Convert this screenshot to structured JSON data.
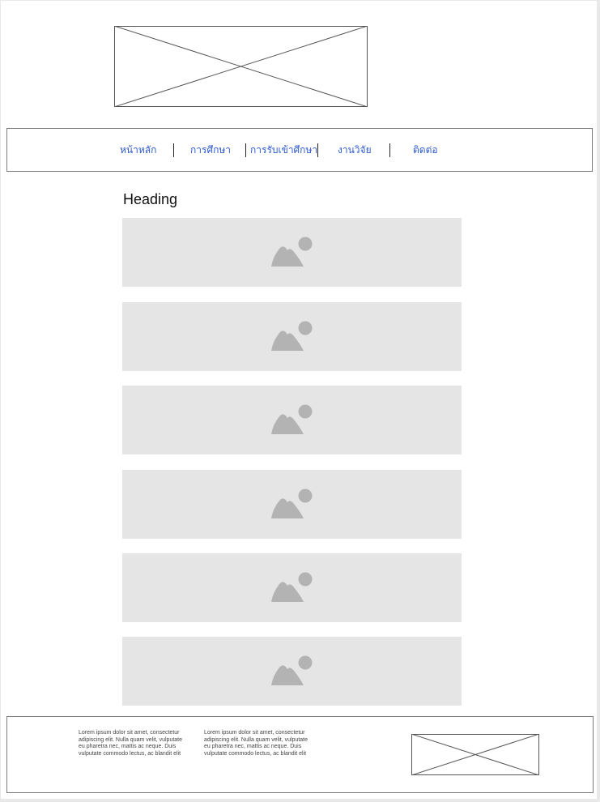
{
  "header": {
    "logo_icon": "image-placeholder-crossed-box"
  },
  "nav": {
    "items": [
      {
        "label": "หน้าหลัก"
      },
      {
        "label": "การศึกษา"
      },
      {
        "label": "การรับเข้าศึกษา"
      },
      {
        "label": "งานวิจัย"
      },
      {
        "label": "ติดต่อ"
      }
    ],
    "link_color": "#2f5bd0"
  },
  "main": {
    "heading": "Heading",
    "image_icon": "image-mountain-sun-icon",
    "image_count": 6
  },
  "footer": {
    "col1_text": "Lorem ipsum dolor sit amet, consectetur adipiscing elit. Nulla quam velit, vulputate eu pharetra nec, mattis ac neque. Duis vulputate commodo lectus, ac blandit elit",
    "col2_text": "Lorem ipsum dolor sit amet, consectetur adipiscing elit. Nulla quam velit, vulputate eu pharetra nec, mattis ac neque. Duis vulputate commodo lectus, ac blandit elit",
    "logo_icon": "image-placeholder-crossed-box"
  }
}
